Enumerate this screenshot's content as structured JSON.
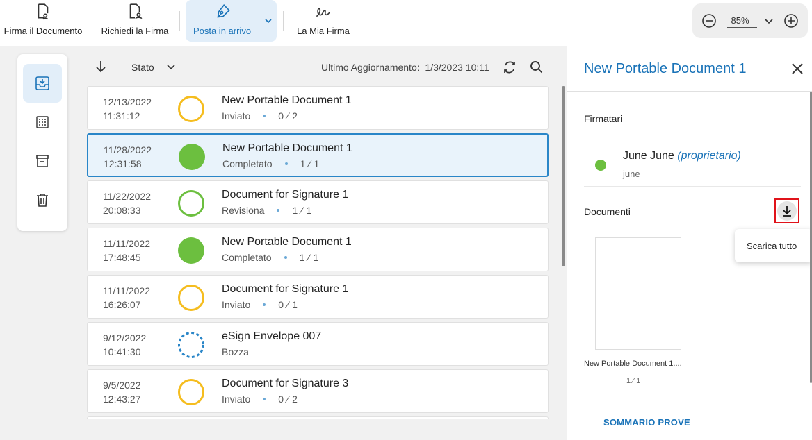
{
  "toolbar": {
    "sign_document": "Firma il Documento",
    "request_signature": "Richiedi la Firma",
    "inbox": "Posta in arrivo",
    "my_signature": "La Mia Firma",
    "zoom_value": "85%"
  },
  "list_header": {
    "filter_label": "Stato",
    "updated_label": "Ultimo Aggiornamento:",
    "updated_value": "1/3/2023 10:11"
  },
  "rows": [
    {
      "date": "12/13/2022",
      "time": "11:31:12",
      "title": "New Portable Document 1",
      "status": "Inviato",
      "count": "0 ⁄ 2",
      "status_type": "sent"
    },
    {
      "date": "11/28/2022",
      "time": "12:31:58",
      "title": "New Portable Document 1",
      "status": "Completato",
      "count": "1 ⁄ 1",
      "status_type": "completed"
    },
    {
      "date": "11/22/2022",
      "time": "20:08:33",
      "title": "Document for Signature 1",
      "status": "Revisiona",
      "count": "1 ⁄ 1",
      "status_type": "review"
    },
    {
      "date": "11/11/2022",
      "time": "17:48:45",
      "title": "New Portable Document 1",
      "status": "Completato",
      "count": "1 ⁄ 1",
      "status_type": "completed"
    },
    {
      "date": "11/11/2022",
      "time": "16:26:07",
      "title": "Document for Signature 1",
      "status": "Inviato",
      "count": "0 ⁄ 1",
      "status_type": "sent"
    },
    {
      "date": "9/12/2022",
      "time": "10:41:30",
      "title": "eSign Envelope 007",
      "status": "Bozza",
      "count": "",
      "status_type": "draft"
    },
    {
      "date": "9/5/2022",
      "time": "12:43:27",
      "title": "Document for Signature 3",
      "status": "Inviato",
      "count": "0 ⁄ 2",
      "status_type": "sent"
    }
  ],
  "panel": {
    "title": "New Portable Document 1",
    "signers_label": "Firmatari",
    "signer_name": "June June",
    "signer_role": "(proprietario)",
    "signer_user": "june",
    "documents_label": "Documenti",
    "download_all": "Scarica tutto",
    "doc_name": "New Portable Document 1....",
    "doc_pages": "1 ⁄ 1",
    "summary": "SOMMARIO PROVE"
  },
  "colors": {
    "accent": "#1a73b8",
    "sent": "#f5bd1f",
    "completed": "#6cbf3f",
    "draft": "#2a86c8"
  }
}
